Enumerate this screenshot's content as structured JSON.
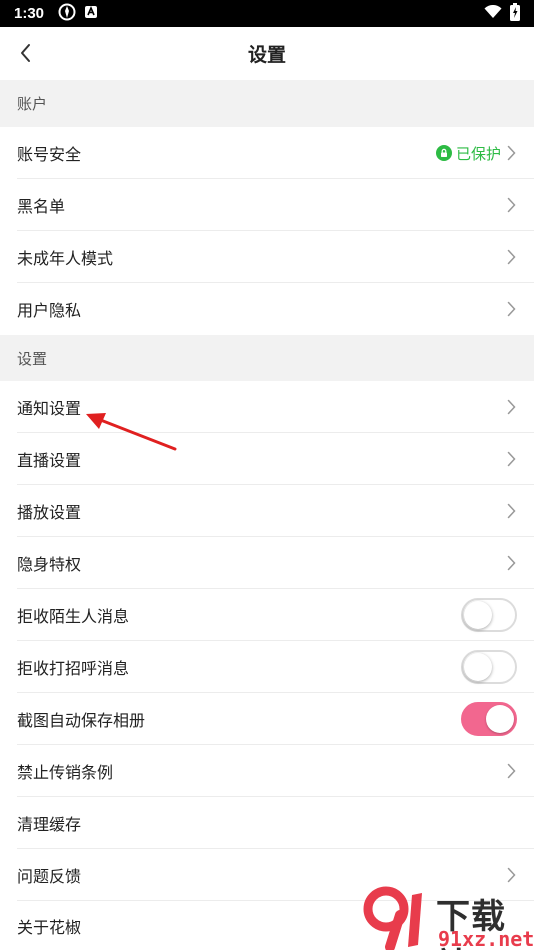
{
  "status_bar": {
    "time": "1:30"
  },
  "nav": {
    "title": "设置"
  },
  "sections": {
    "account": "账户",
    "settings": "设置"
  },
  "account_rows": {
    "security": {
      "label": "账号安全",
      "status": "已保护"
    },
    "blacklist": {
      "label": "黑名单"
    },
    "minor_mode": {
      "label": "未成年人模式"
    },
    "privacy": {
      "label": "用户隐私"
    }
  },
  "settings_rows": {
    "notification": {
      "label": "通知设置"
    },
    "live": {
      "label": "直播设置"
    },
    "playback": {
      "label": "播放设置"
    },
    "stealth": {
      "label": "隐身特权"
    },
    "reject_strangers": {
      "label": "拒收陌生人消息",
      "on": false
    },
    "reject_greetings": {
      "label": "拒收打招呼消息",
      "on": false
    },
    "screenshot_save": {
      "label": "截图自动保存相册",
      "on": true
    },
    "anti_mlm": {
      "label": "禁止传销条例"
    },
    "clear_cache": {
      "label": "清理缓存"
    },
    "feedback": {
      "label": "问题反馈"
    },
    "about": {
      "label": "关于花椒"
    }
  },
  "watermark": {
    "brand": "下载站",
    "url": "91xz.net"
  },
  "colors": {
    "accent_pink": "#f2678f",
    "protected_green": "#2dbb44",
    "annotation_red": "#e02020"
  }
}
